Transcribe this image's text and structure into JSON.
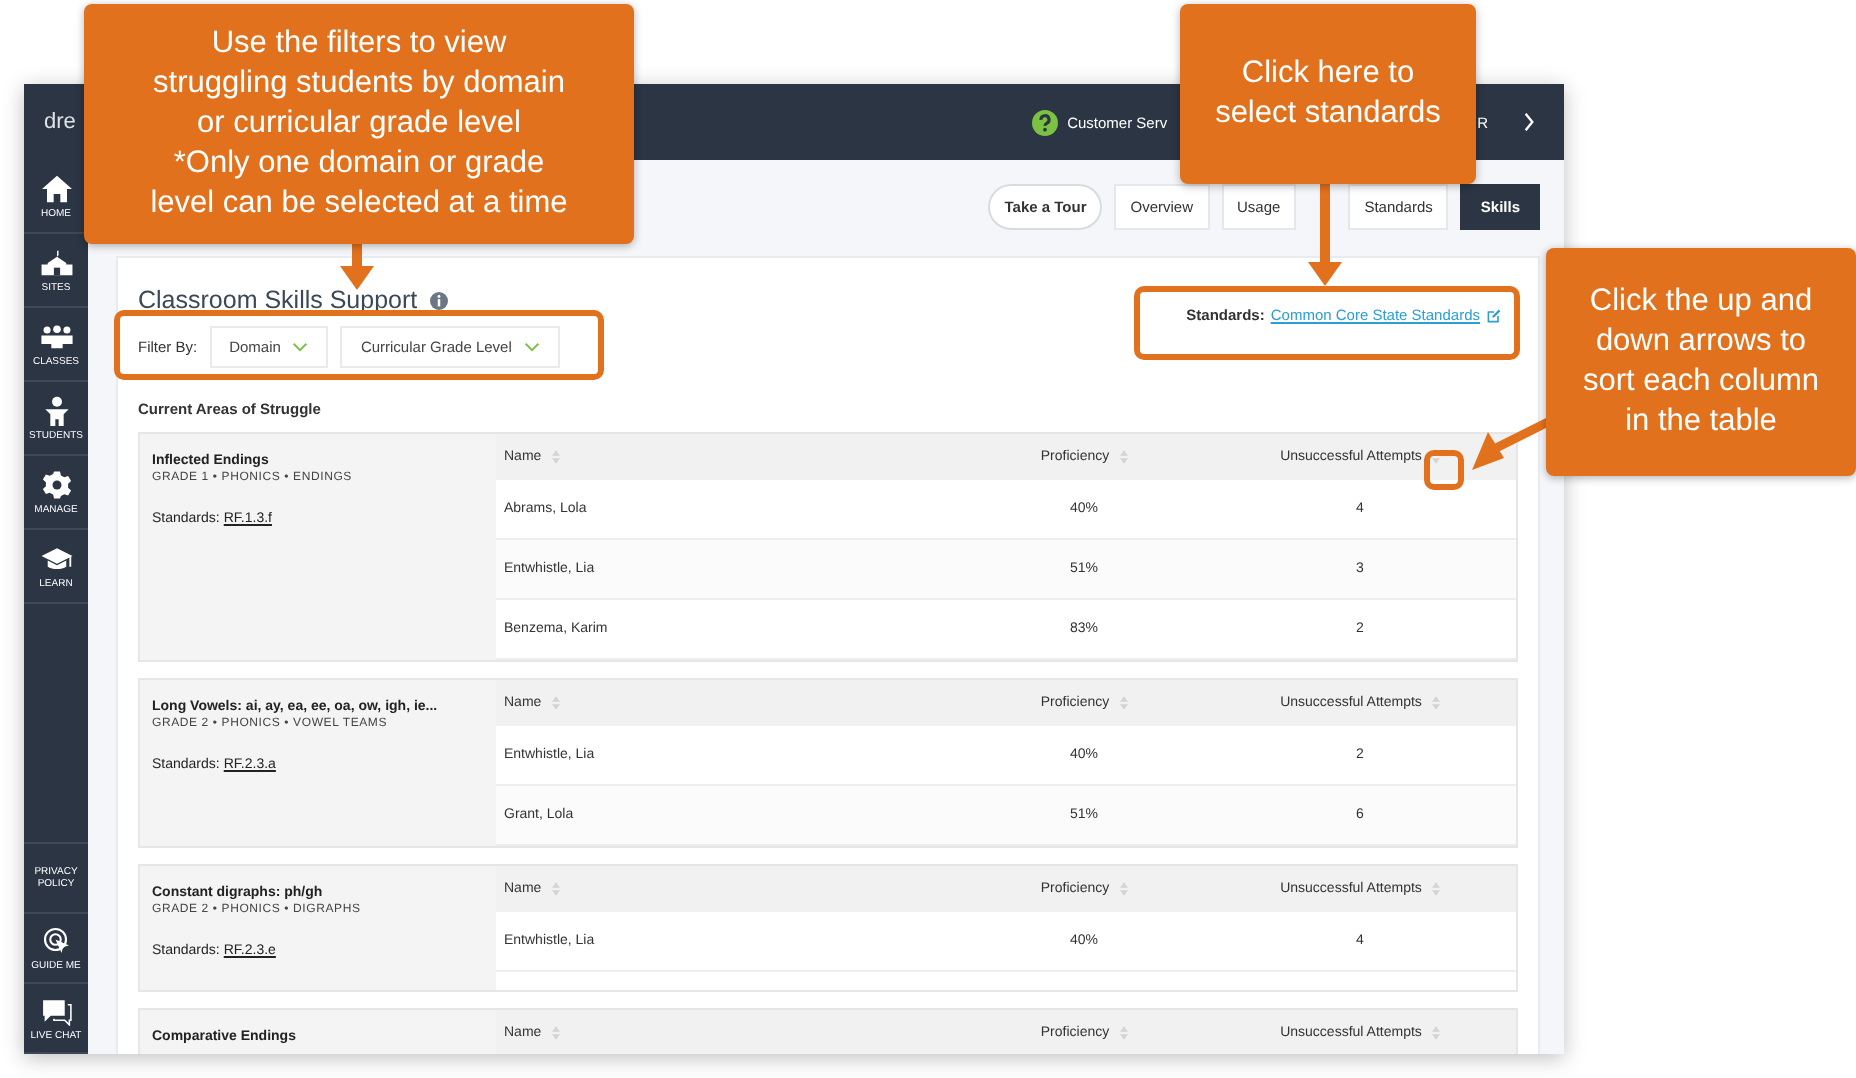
{
  "topbar": {
    "logo": "dre",
    "help_text": "Customer Serv",
    "user_text": "R"
  },
  "sidebar": {
    "items": [
      {
        "label": "HOME"
      },
      {
        "label": "SITES"
      },
      {
        "label": "CLASSES"
      },
      {
        "label": "STUDENTS"
      },
      {
        "label": "MANAGE"
      },
      {
        "label": "LEARN"
      }
    ],
    "bottom_items": [
      {
        "label": "PRIVACY POLICY"
      },
      {
        "label": "GUIDE ME"
      },
      {
        "label": "LIVE CHAT"
      }
    ]
  },
  "tour_button": "Take a Tour",
  "tabs": [
    {
      "label": "Overview",
      "selected": false
    },
    {
      "label": "Usage",
      "selected": false
    },
    {
      "label": "Standards",
      "selected": false
    },
    {
      "label": "Skills",
      "selected": true
    }
  ],
  "card": {
    "title": "Classroom Skills Support",
    "filter_label": "Filter By:",
    "filters": [
      {
        "label": "Domain"
      },
      {
        "label": "Curricular Grade Level"
      }
    ],
    "standards_label": "Standards:",
    "standards_link": "Common Core State Standards",
    "section_title": "Current Areas of Struggle",
    "groups": [
      {
        "title": "Inflected Endings",
        "meta": "GRADE 1 • PHONICS • ENDINGS",
        "standards_label": "Standards:",
        "standard": "RF.1.3.f",
        "columns": [
          "Name",
          "Proficiency",
          "Unsuccessful Attempts"
        ],
        "rows": [
          [
            "Abrams, Lola",
            "40%",
            "4"
          ],
          [
            "Entwhistle, Lia",
            "51%",
            "3"
          ],
          [
            "Benzema, Karim",
            "83%",
            "2"
          ]
        ]
      },
      {
        "title": "Long Vowels: ai, ay, ea, ee, oa, ow, igh, ie...",
        "meta": "GRADE 2 • PHONICS • VOWEL TEAMS",
        "standards_label": "Standards:",
        "standard": "RF.2.3.a",
        "columns": [
          "Name",
          "Proficiency",
          "Unsuccessful Attempts"
        ],
        "rows": [
          [
            "Entwhistle, Lia",
            "40%",
            "2"
          ],
          [
            "Grant, Lola",
            "51%",
            "6"
          ]
        ]
      },
      {
        "title": "Constant digraphs: ph/gh",
        "meta": "GRADE 2 • PHONICS • DIGRAPHS",
        "standards_label": "Standards:",
        "standard": "RF.2.3.e",
        "columns": [
          "Name",
          "Proficiency",
          "Unsuccessful Attempts"
        ],
        "rows": [
          [
            "Entwhistle, Lia",
            "40%",
            "4"
          ]
        ]
      },
      {
        "title": "Comparative Endings",
        "columns": [
          "Name",
          "Proficiency",
          "Unsuccessful Attempts"
        ]
      }
    ]
  },
  "callouts": [
    {
      "lines": [
        "Use the filters to view",
        "struggling students by domain",
        "or curricular grade level",
        "*Only one domain or grade",
        "level can be selected at a time"
      ]
    },
    {
      "lines": [
        "Click here to",
        "select standards"
      ]
    },
    {
      "lines": [
        "Click the up and",
        "down arrows to",
        "sort each column",
        "in the table"
      ]
    }
  ]
}
